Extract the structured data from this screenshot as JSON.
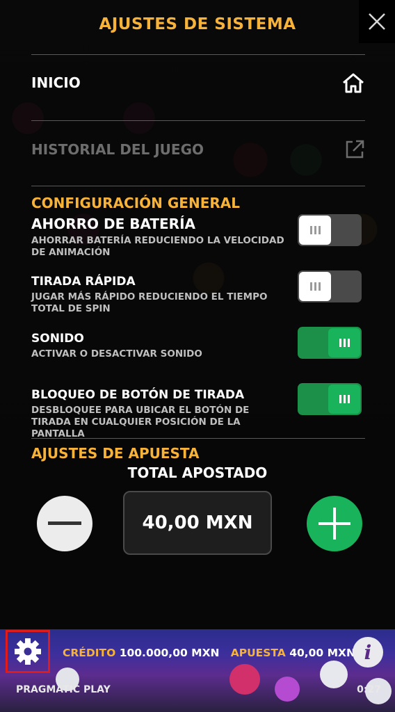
{
  "header": {
    "title": "AJUSTES DE SISTEMA",
    "close_icon": "close-icon"
  },
  "links": [
    {
      "label": "INICIO",
      "icon": "home-icon",
      "enabled": true
    },
    {
      "label": "HISTORIAL DEL JUEGO",
      "icon": "external-link-icon",
      "enabled": false
    }
  ],
  "general": {
    "title": "CONFIGURACIÓN GENERAL",
    "settings": [
      {
        "label": "AHORRO DE BATERÍA",
        "description": "AHORRAR BATERÍA REDUCIENDO LA VELOCIDAD DE ANIMACIÓN",
        "on": false
      },
      {
        "label": "TIRADA RÁPIDA",
        "description": "JUGAR MÁS RÁPIDO REDUCIENDO EL TIEMPO TOTAL DE SPIN",
        "on": false
      },
      {
        "label": "SONIDO",
        "description": "ACTIVAR O DESACTIVAR SONIDO",
        "on": true
      },
      {
        "label": "BLOQUEO DE BOTÓN DE TIRADA",
        "description": "DESBLOQUEE PARA UBICAR EL BOTÓN DE TIRADA EN CUALQUIER POSICIÓN DE LA PANTALLA",
        "on": true
      }
    ]
  },
  "bet": {
    "title": "AJUSTES DE APUESTA",
    "total_label": "TOTAL APOSTADO",
    "value": "40,00 MXN"
  },
  "bottom_bar": {
    "credit_label": "CRÉDITO",
    "credit_value": "100.000,00 MXN",
    "bet_label": "APUESTA",
    "bet_value": "40,00 MXN",
    "brand": "PRAGMATIC PLAY",
    "clock": "0:27",
    "info_glyph": "i"
  },
  "colors": {
    "accent": "#f7b23a",
    "toggle_on": "#18b35a",
    "highlight_border": "#e01b1b"
  }
}
